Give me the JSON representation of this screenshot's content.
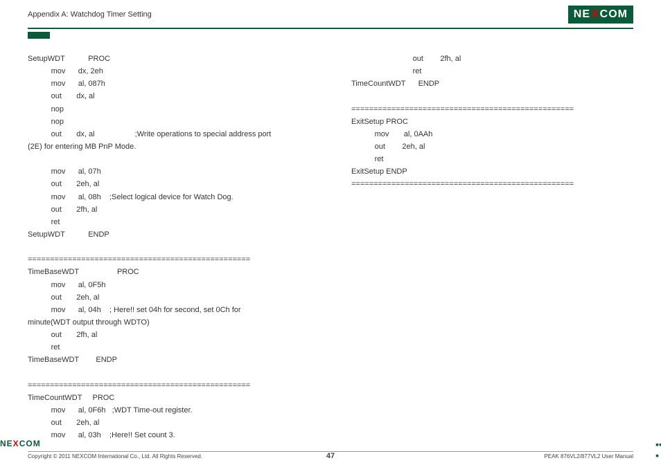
{
  "header": {
    "title": "Appendix A: Watchdog Timer Setting",
    "logo_parts": [
      "NE",
      "X",
      "COM"
    ]
  },
  "left": [
    "SetupWDT           PROC",
    "           mov      dx, 2eh",
    "           mov      al, 087h",
    "           out       dx, al",
    "           nop",
    "           nop",
    "           out       dx, al                   ;Write operations to special address port",
    "(2E) for entering MB PnP Mode.",
    "",
    "           mov      al, 07h",
    "           out       2eh, al",
    "           mov      al, 08h    ;Select logical device for Watch Dog.",
    "           out       2fh, al",
    "           ret",
    "SetupWDT           ENDP",
    "",
    "==================================================",
    "TimeBaseWDT                  PROC",
    "           mov      al, 0F5h",
    "           out       2eh, al",
    "           mov      al, 04h    ; Here!! set 04h for second, set 0Ch for",
    "minute(WDT output through WDTO)",
    "           out       2fh, al",
    "           ret",
    "TimeBaseWDT        ENDP",
    "",
    "==================================================",
    "TimeCountWDT     PROC",
    "           mov      al, 0F6h   ;WDT Time-out register.",
    "           out       2eh, al",
    "           mov      al, 03h    ;Here!! Set count 3."
  ],
  "right": [
    "                             out        2fh, al",
    "                             ret",
    "TimeCountWDT      ENDP",
    "",
    "==================================================",
    "ExitSetup PROC",
    "           mov       al, 0AAh",
    "           out        2eh, al",
    "           ret",
    "ExitSetup ENDP",
    "=================================================="
  ],
  "footer": {
    "logo_parts": [
      "NE",
      "X",
      "COM"
    ],
    "copyright": "Copyright © 2011 NEXCOM International Co., Ltd. All Rights Reserved.",
    "page": "47",
    "manual": "PEAK 876VL2/877VL2 User Manual"
  }
}
